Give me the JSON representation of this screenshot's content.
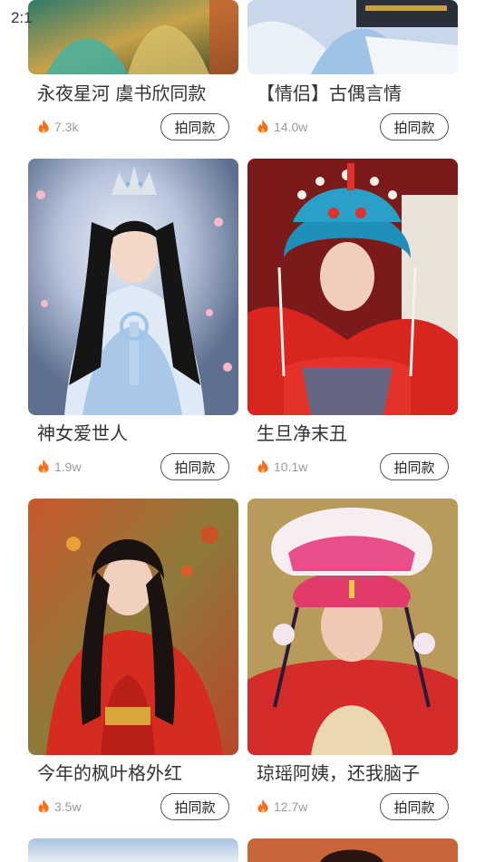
{
  "status_bar": {
    "time": "2:1"
  },
  "cards": [
    {
      "title": "永夜星河 虞书欣同款",
      "count": "7.3k",
      "button": "拍同款"
    },
    {
      "title": "【情侣】古偶言情",
      "count": "14.0w",
      "button": "拍同款"
    },
    {
      "title": "神女爱世人",
      "count": "1.9w",
      "button": "拍同款"
    },
    {
      "title": "生旦净末丑",
      "count": "10.1w",
      "button": "拍同款"
    },
    {
      "title": "今年的枫叶格外红",
      "count": "3.5w",
      "button": "拍同款"
    },
    {
      "title": "琼瑶阿姨，还我脑子",
      "count": "12.7w",
      "button": "拍同款"
    }
  ],
  "colors": {
    "fire": "#ff6a1a",
    "title": "#333333",
    "count": "#9a9a9a"
  }
}
